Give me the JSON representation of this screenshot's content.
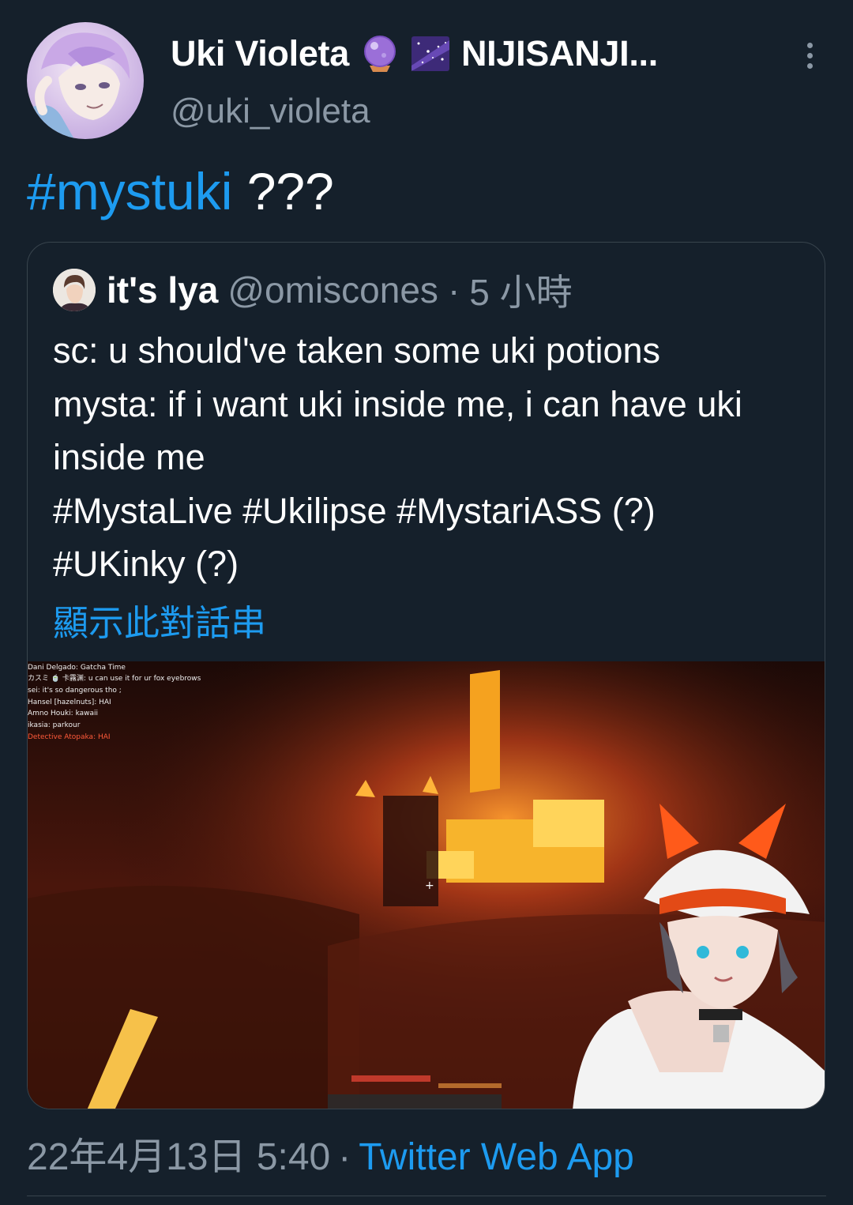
{
  "author": {
    "display_name": "Uki Violeta",
    "affiliation": "NIJISANJI...",
    "handle": "@uki_violeta",
    "badges": [
      "crystal-ball-emoji",
      "milky-way-emoji"
    ]
  },
  "tweet": {
    "hashtag": "#mystuki",
    "text": " ???"
  },
  "quoted_tweet": {
    "display_name": "it's lya",
    "handle": "@omiscones",
    "separator": "·",
    "time": "5 小時",
    "body": "sc: u should've taken some uki potions\nmysta: if i want uki inside me, i can have uki inside me\n#MystaLive #Ukilipse #MystariASS (?)\n#UKinky (?)",
    "show_thread": "顯示此對話串",
    "media": {
      "chat_lines": [
        "Dani Delgado: Gatcha Time",
        "カスミ 🍵 卡霧渊: u can use it for ur fox eyebrows",
        "sei: it's so dangerous tho ;",
        "Hansel [hazelnuts]: HAI",
        "Amno Houki: kawaii",
        "ikasia: parkour",
        "Detective Atopaka: HAI"
      ]
    }
  },
  "footer": {
    "timestamp": "22年4月13日 5:40",
    "separator": "·",
    "source": "Twitter Web App"
  },
  "colors": {
    "background": "#15202b",
    "accent": "#1d9bf0",
    "secondary_text": "#8b98a5",
    "border": "#38444d"
  }
}
